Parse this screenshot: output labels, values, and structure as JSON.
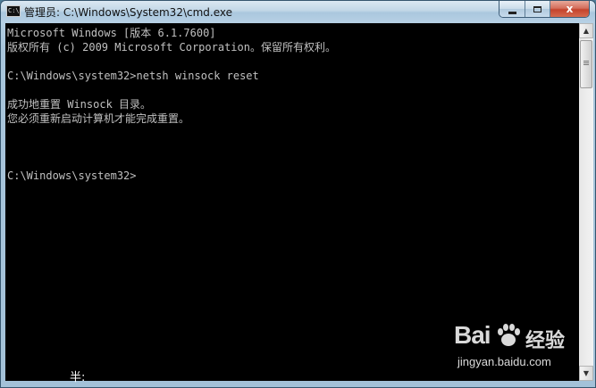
{
  "window": {
    "title": "管理员: C:\\Windows\\System32\\cmd.exe",
    "icon": "cmd-console-icon",
    "controls": {
      "minimize": "minimize-icon",
      "maximize": "maximize-icon",
      "close_label": "x"
    }
  },
  "console": {
    "lines": [
      "Microsoft Windows [版本 6.1.7600]",
      "版权所有 (c) 2009 Microsoft Corporation。保留所有权利。",
      "",
      "C:\\Windows\\system32>netsh winsock reset",
      "",
      "成功地重置 Winsock 目录。",
      "您必须重新启动计算机才能完成重置。",
      "",
      "",
      "",
      "C:\\Windows\\system32>"
    ],
    "text_color": "#c0c0c0",
    "background": "#000000"
  },
  "scrollbar": {
    "up_icon": "scroll-up-arrow-icon",
    "down_icon": "scroll-down-arrow-icon"
  },
  "ime": {
    "indicator": "半:"
  },
  "watermark": {
    "brand": "Bai",
    "suffix": "经验",
    "domain": "jingyan.baidu.com"
  }
}
